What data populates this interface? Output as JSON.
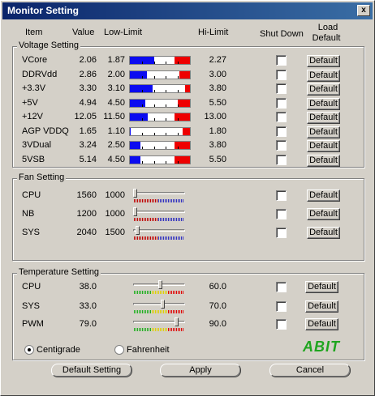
{
  "window": {
    "title": "Monitor Setting",
    "close_glyph": "x"
  },
  "headers": {
    "item": "Item",
    "value": "Value",
    "low_limit": "Low-Limit",
    "hi_limit": "Hi-Limit",
    "shut_down": "Shut Down",
    "load_default_l1": "Load",
    "load_default_l2": "Default"
  },
  "voltage": {
    "title": "Voltage Setting",
    "rows": [
      {
        "name": "VCore",
        "value": "2.06",
        "low": "1.87",
        "hi": "2.27",
        "blue": 0.4,
        "red": 0.26,
        "default": "Default"
      },
      {
        "name": "DDRVdd",
        "value": "2.86",
        "low": "2.00",
        "hi": "3.00",
        "blue": 0.28,
        "red": 0.18,
        "default": "Default"
      },
      {
        "name": "+3.3V",
        "value": "3.30",
        "low": "3.10",
        "hi": "3.80",
        "blue": 0.38,
        "red": 0.08,
        "default": "Default"
      },
      {
        "name": "+5V",
        "value": "4.94",
        "low": "4.50",
        "hi": "5.50",
        "blue": 0.25,
        "red": 0.2,
        "default": "Default"
      },
      {
        "name": "+12V",
        "value": "12.05",
        "low": "11.50",
        "hi": "13.00",
        "blue": 0.3,
        "red": 0.26,
        "default": "Default"
      },
      {
        "name": "AGP VDDQ",
        "value": "1.65",
        "low": "1.10",
        "hi": "1.80",
        "blue": 0.02,
        "red": 0.12,
        "default": "Default"
      },
      {
        "name": "3VDual",
        "value": "3.24",
        "low": "2.50",
        "hi": "3.80",
        "blue": 0.18,
        "red": 0.26,
        "default": "Default"
      },
      {
        "name": "5VSB",
        "value": "5.14",
        "low": "4.50",
        "hi": "5.50",
        "blue": 0.18,
        "red": 0.26,
        "default": "Default"
      }
    ]
  },
  "fan": {
    "title": "Fan Setting",
    "rows": [
      {
        "name": "CPU",
        "value": "1560",
        "low": "1000",
        "thumb": 0.0,
        "default": "Default"
      },
      {
        "name": "NB",
        "value": "1200",
        "low": "1000",
        "thumb": 0.0,
        "default": "Default"
      },
      {
        "name": "SYS",
        "value": "2040",
        "low": "1500",
        "thumb": 0.05,
        "default": "Default"
      }
    ]
  },
  "temperature": {
    "title": "Temperature Setting",
    "rows": [
      {
        "name": "CPU",
        "value": "38.0",
        "hi": "60.0",
        "thumb": 0.52,
        "default": "Default"
      },
      {
        "name": "SYS",
        "value": "33.0",
        "hi": "70.0",
        "thumb": 0.58,
        "default": "Default"
      },
      {
        "name": "PWM",
        "value": "79.0",
        "hi": "90.0",
        "thumb": 0.86,
        "default": "Default"
      }
    ]
  },
  "units": {
    "centigrade": "Centigrade",
    "fahrenheit": "Fahrenheit",
    "selected": "centigrade"
  },
  "logo": "ABIT",
  "buttons": {
    "default_setting": "Default Setting",
    "apply": "Apply",
    "cancel": "Cancel"
  },
  "colors": {
    "title_start": "#0a246a",
    "title_end": "#3a6ea5",
    "bar_blue": "#0b0bf0",
    "bar_red": "#ee0000",
    "logo_green": "#1fa51f"
  }
}
